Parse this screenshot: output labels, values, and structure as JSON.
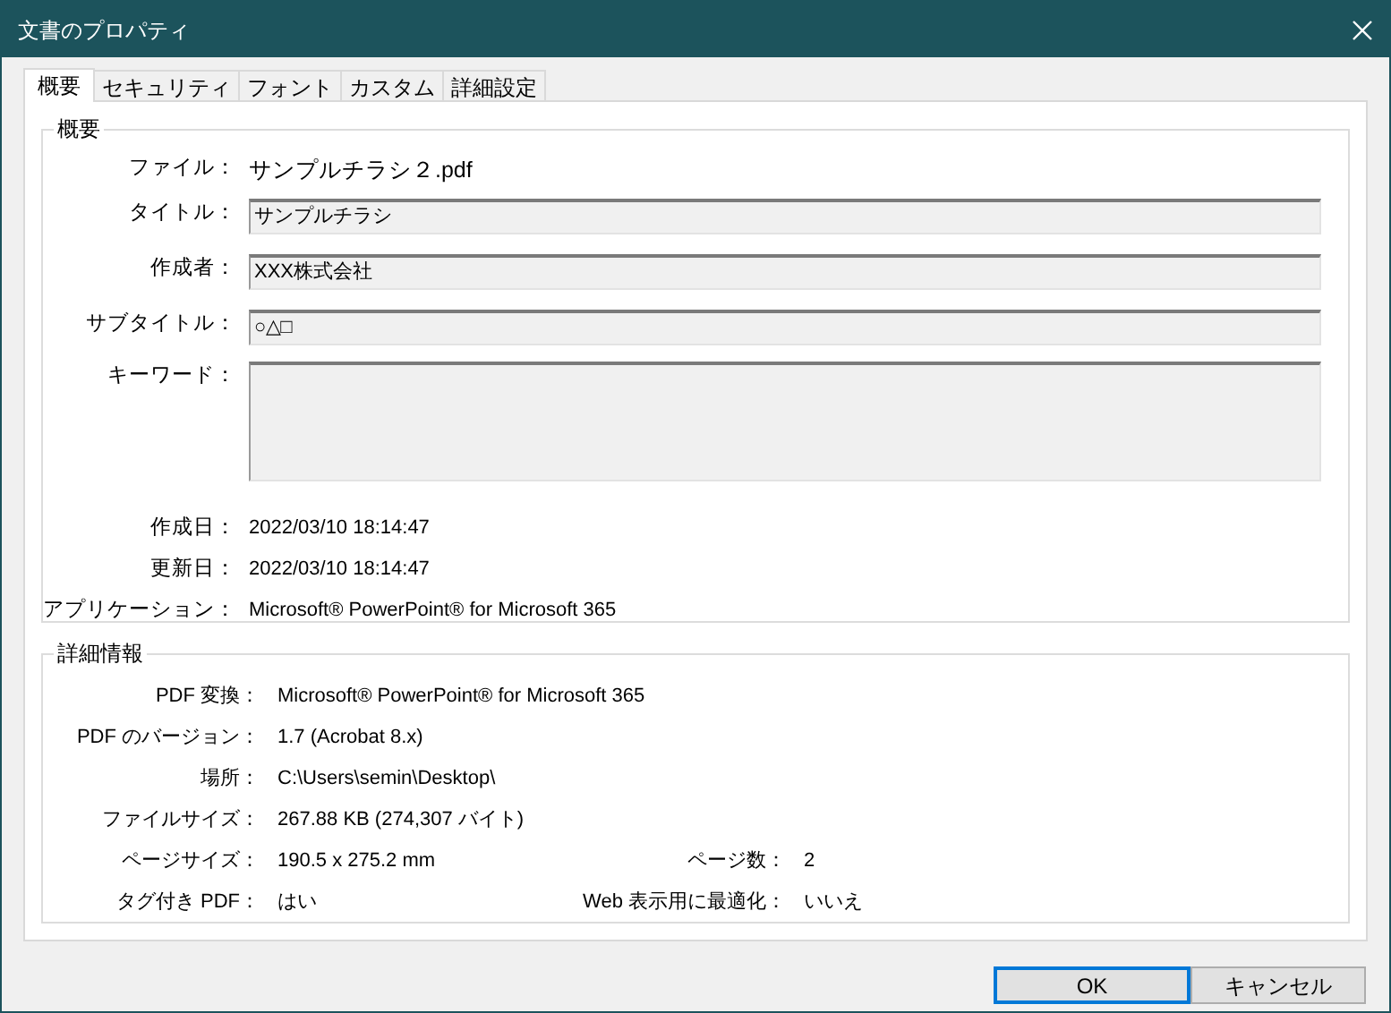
{
  "window": {
    "title": "文書のプロパティ"
  },
  "tabs": [
    {
      "label": "概要",
      "selected": true
    },
    {
      "label": "セキュリティ",
      "selected": false
    },
    {
      "label": "フォント",
      "selected": false
    },
    {
      "label": "カスタム",
      "selected": false
    },
    {
      "label": "詳細設定",
      "selected": false
    }
  ],
  "summary": {
    "title": "概要",
    "rows": [
      {
        "kind": "text",
        "label": "ファイル：",
        "value": "サンプルチラシ２.pdf"
      },
      {
        "kind": "field",
        "label": "タイトル：",
        "value": "サンプルチラシ"
      },
      {
        "kind": "field",
        "label": "作成者：",
        "value": "XXX株式会社"
      },
      {
        "kind": "field",
        "label": "サブタイトル：",
        "value": "○△□"
      },
      {
        "kind": "area",
        "label": "キーワード："
      },
      {
        "kind": "small",
        "label": "作成日：",
        "value": "2022/03/10 18:14:47"
      },
      {
        "kind": "small",
        "label": "更新日：",
        "value": "2022/03/10 18:14:47"
      },
      {
        "kind": "small",
        "label": "アプリケーション：",
        "value": "Microsoft® PowerPoint® for Microsoft 365"
      }
    ]
  },
  "details": {
    "title": "詳細情報",
    "rows": [
      {
        "label": "PDF 変換：",
        "value": "Microsoft® PowerPoint® for Microsoft 365"
      },
      {
        "label": "PDF のバージョン：",
        "value": "1.7 (Acrobat 8.x)"
      },
      {
        "label": "場所：",
        "value": "C:\\Users\\semin\\Desktop\\"
      },
      {
        "label": "ファイルサイズ：",
        "value": "267.88 KB (274,307 バイト)"
      },
      {
        "label": "ページサイズ：",
        "value": "190.5 x 275.2 mm",
        "label_2": "ページ数：",
        "value_2": "2"
      },
      {
        "label": "タグ付き PDF：",
        "value": "はい",
        "label_2": "Web 表示用に最適化：",
        "value_2": "いいえ"
      }
    ]
  },
  "buttons": [
    {
      "label": "OK",
      "focused": true
    },
    {
      "label": "キャンセル",
      "focused": false
    }
  ]
}
